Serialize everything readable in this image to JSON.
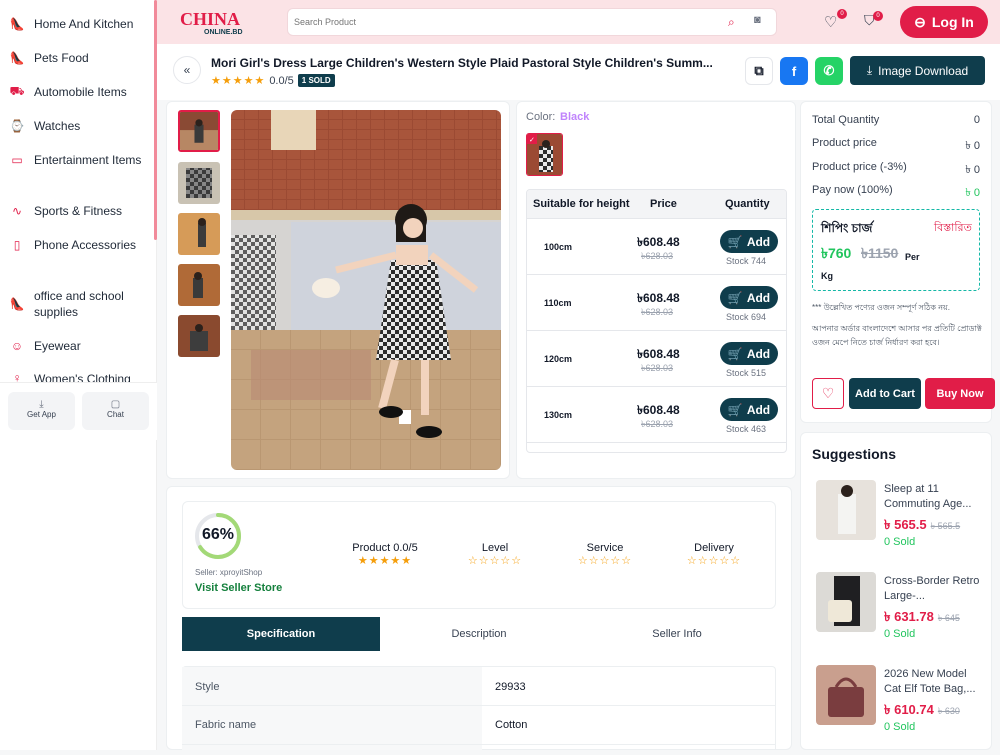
{
  "sidebar": {
    "items": [
      {
        "label": "Home And Kitchen",
        "icon": "shoe-icon"
      },
      {
        "label": "Pets Food",
        "icon": "shoe-icon"
      },
      {
        "label": "Automobile Items",
        "icon": "truck-icon"
      },
      {
        "label": "Watches",
        "icon": "watch-icon"
      },
      {
        "label": "Entertainment Items",
        "icon": "tv-icon"
      },
      {
        "label": "Sports & Fitness",
        "icon": "activity-icon"
      },
      {
        "label": "Phone Accessories",
        "icon": "phone-icon"
      },
      {
        "label": "office and school supplies",
        "icon": "shoe-icon"
      },
      {
        "label": "Eyewear",
        "icon": "smile-icon"
      },
      {
        "label": "Women's Clothing",
        "icon": "dress-icon"
      }
    ],
    "get_app": "Get App",
    "chat": "Chat"
  },
  "header": {
    "logo_text": "CHINA",
    "logo_sub": "ONLINE.BD",
    "search_placeholder": "Search Product",
    "wishlist_count": "0",
    "cart_count": "0",
    "login": "Log In"
  },
  "product": {
    "title": "Mori Girl's Dress Large Children's Western Style Plaid Pastoral Style Children's Summ...",
    "rating": "0.0/5",
    "sold": "1 SOLD",
    "image_download": "Image Download"
  },
  "variant": {
    "color_label": "Color:",
    "color_value": "Black",
    "headers": [
      "Suitable for height",
      "Price",
      "Quantity"
    ],
    "rows": [
      {
        "size": "100cm",
        "price": "৳608.48",
        "old": "৳628.03",
        "stock": "Stock 744"
      },
      {
        "size": "110cm",
        "price": "৳608.48",
        "old": "৳628.03",
        "stock": "Stock 694"
      },
      {
        "size": "120cm",
        "price": "৳608.48",
        "old": "৳628.03",
        "stock": "Stock 515"
      },
      {
        "size": "130cm",
        "price": "৳608.48",
        "old": "৳628.03",
        "stock": "Stock 463"
      }
    ],
    "add_label": "Add"
  },
  "summary": {
    "total_quantity_label": "Total Quantity",
    "total_quantity": "0",
    "product_price_label": "Product price",
    "product_price": "৳ 0",
    "discount_label": "Product price (-3%)",
    "discount_price": "৳ 0",
    "pay_now_label": "Pay now (100%)",
    "pay_now": "৳ 0",
    "shipping_title": "শিপিং চার্জ",
    "shipping_details": "বিস্তারিত",
    "shipping_price": "৳760",
    "shipping_old": "৳1150",
    "shipping_unit": "Per Kg",
    "note1": "*** উল্লেখিত পণ্যের ওজন সম্পূর্ণ সঠিক নয়.",
    "note2": "আপনার অর্ডার বাংলাদেশে আসার পর প্রতিটি প্রোডাক্ট ওজন মেপে নিতে চার্জ নির্ধারণ করা হবে।",
    "add_to_cart": "Add to Cart",
    "buy_now": "Buy Now"
  },
  "suggestions": {
    "title": "Suggestions",
    "items": [
      {
        "name": "Sleep at 11 Commuting Age...",
        "price": "৳ 565.5",
        "old": "৳ 565.5",
        "sold": "0 Sold"
      },
      {
        "name": "Cross-Border Retro Large-...",
        "price": "৳ 631.78",
        "old": "৳ 645",
        "sold": "0 Sold"
      },
      {
        "name": "2026 New Model Cat Elf Tote Bag,...",
        "price": "৳ 610.74",
        "old": "৳ 630",
        "sold": "0 Sold"
      }
    ]
  },
  "seller": {
    "score": "66%",
    "score_value": 0.66,
    "name": "Seller: xproyitShop",
    "visit": "Visit Seller Store",
    "metrics": [
      {
        "label": "Product 0.0/5",
        "stars": "★★★★★",
        "filled": true
      },
      {
        "label": "Level",
        "stars": "☆☆☆☆☆",
        "filled": false
      },
      {
        "label": "Service",
        "stars": "☆☆☆☆☆",
        "filled": false
      },
      {
        "label": "Delivery",
        "stars": "☆☆☆☆☆",
        "filled": false
      }
    ]
  },
  "tabs": [
    "Specification",
    "Description",
    "Seller Info"
  ],
  "specs": [
    {
      "key": "Style",
      "value": "29933"
    },
    {
      "key": "Fabric name",
      "value": "Cotton"
    }
  ],
  "colors": {
    "accent": "#e11d48",
    "dark": "#0f3d4c",
    "green": "#22c55e",
    "header_bg": "#fbe3e6"
  }
}
